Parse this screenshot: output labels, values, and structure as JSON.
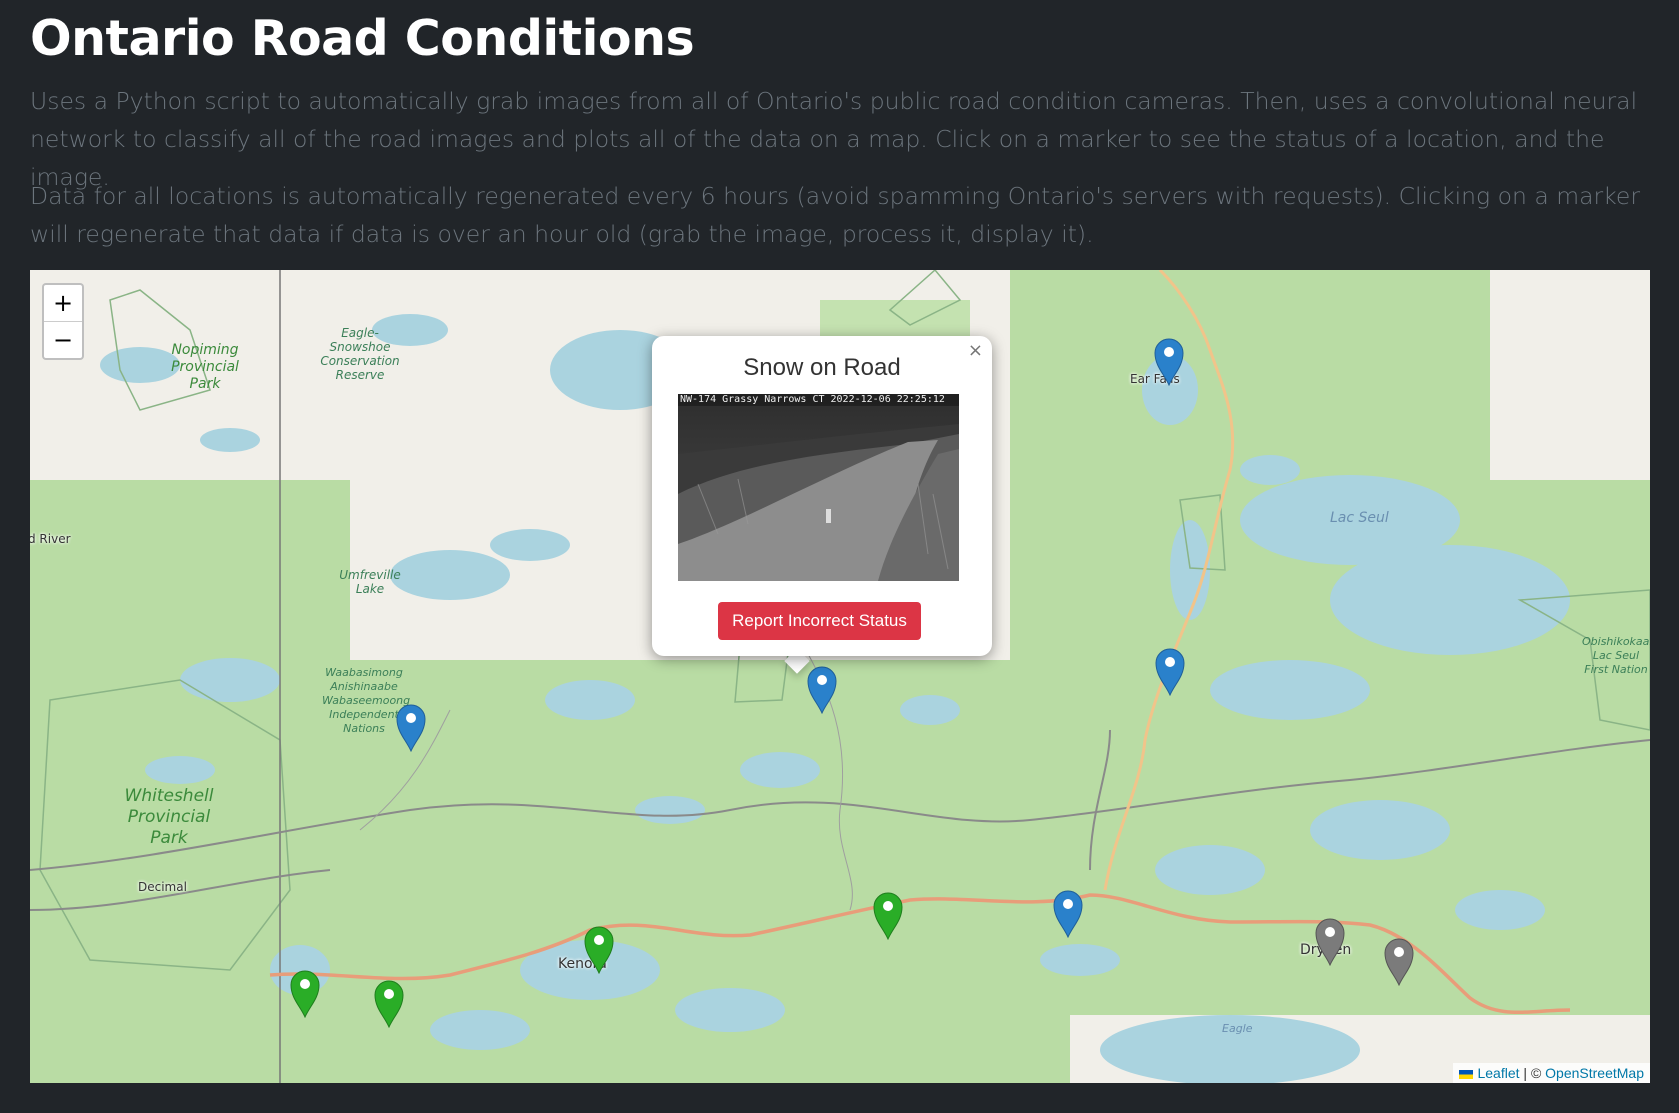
{
  "page": {
    "title": "Ontario Road Conditions",
    "description_1": "Uses a Python script to automatically grab images from all of Ontario's public road condition cameras. Then, uses a convolutional neural network to classify all of the road images and plots all of the data on a map. Click on a marker to see the status of a location, and the image.",
    "description_2": "Data for all locations is automatically regenerated every 6 hours (avoid spamming Ontario's servers with requests). Clicking on a marker will regenerate that data if data is over an hour old (grab the image, process it, display it)."
  },
  "map": {
    "zoom_in_label": "+",
    "zoom_out_label": "−",
    "labels": {
      "nopiming": "Nopiming Provincial Park",
      "eagle_snowshoe": "Eagle-Snowshoe Conservation Reserve",
      "umfreville": "Umfreville Lake",
      "waabasimong": "Waabasimong Anishinaabe Wabaseemoong Independent Nations",
      "whiteshell": "Whiteshell Provincial Park",
      "river": "d River",
      "decimal": "Decimal",
      "kenora": "Kenora",
      "dryden": "Dryden",
      "ear_falls": "Ear Falls",
      "lac_seul": "Lac Seul",
      "obishikokaang": "Obishikokaang Lac Seul First Nation",
      "eagle": "Eagle"
    },
    "marker_colors": {
      "blue": "#2a81cb",
      "green": "#2aad27",
      "grey": "#7b7b7b"
    },
    "markers": [
      {
        "color": "blue",
        "status": "unknown"
      },
      {
        "color": "blue",
        "status": "unknown"
      },
      {
        "color": "blue",
        "status": "Snow on Road"
      },
      {
        "color": "blue",
        "status": "unknown"
      },
      {
        "color": "blue",
        "status": "unknown"
      },
      {
        "color": "green",
        "status": "unknown"
      },
      {
        "color": "green",
        "status": "unknown"
      },
      {
        "color": "green",
        "status": "unknown"
      },
      {
        "color": "green",
        "status": "unknown"
      },
      {
        "color": "grey",
        "status": "unknown"
      },
      {
        "color": "grey",
        "status": "unknown"
      }
    ],
    "attribution": {
      "leaflet": "Leaflet",
      "separator": " | © ",
      "osm": "OpenStreetMap"
    }
  },
  "popup": {
    "title": "Snow on Road",
    "image_caption": "NW-174 Grassy Narrows CT 2022-12-06 22:25:12",
    "report_button": "Report Incorrect Status",
    "close_label": "×"
  },
  "colors": {
    "background": "#212529",
    "title": "#ffffff",
    "description": "#6c757d",
    "report_button": "#dc3545",
    "land": "#b9dca4",
    "water": "#aad3df",
    "road": "#e89d7a"
  }
}
